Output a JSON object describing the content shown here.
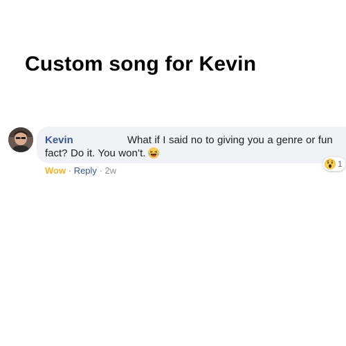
{
  "page": {
    "title": "Custom song for Kevin"
  },
  "comment": {
    "author": "Kevin",
    "text": "What if I said no to giving you a genre or fun fact? Do it. You won’t.",
    "inline_emoji": "laughing-emoji",
    "reaction": {
      "icon": "wow-emoji",
      "count": "1"
    },
    "actions": {
      "wow_label": "Wow",
      "separator": "·",
      "reply_label": "Reply",
      "timestamp": "2w"
    }
  },
  "colors": {
    "author_name": "#385898",
    "bubble_bg": "#f0f2f5",
    "wow_action": "#f7b125",
    "reply_link": "#385898",
    "meta_text": "#90949c"
  }
}
